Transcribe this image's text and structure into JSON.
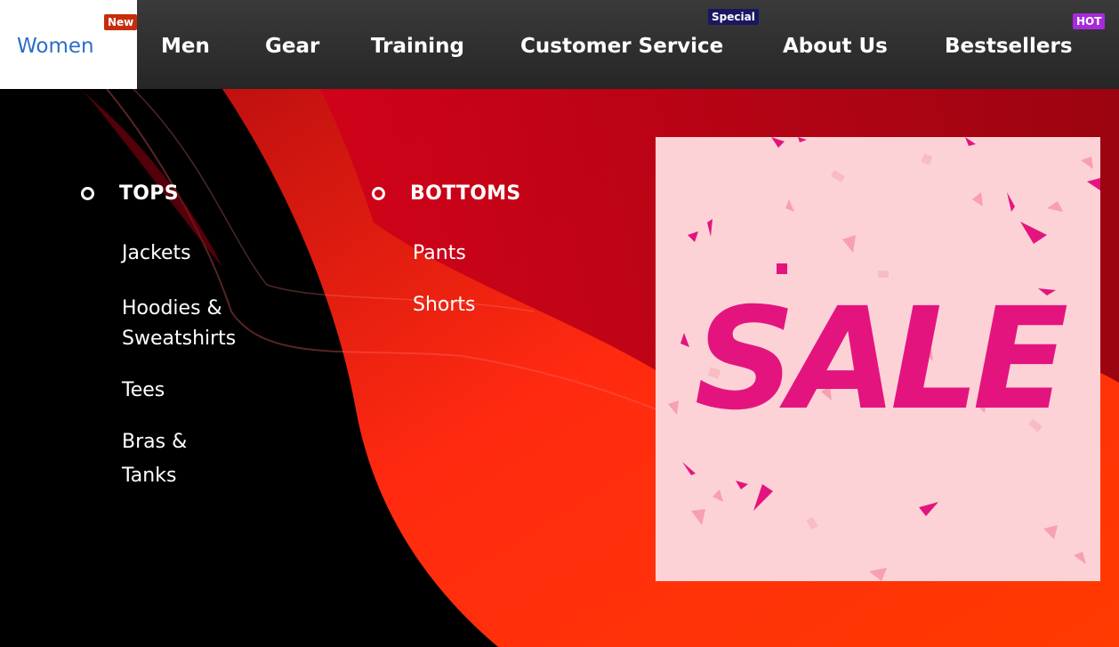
{
  "nav": {
    "items": [
      {
        "label": "Women"
      },
      {
        "label": "Men"
      },
      {
        "label": "Gear"
      },
      {
        "label": "Training"
      },
      {
        "label": "Customer Service"
      },
      {
        "label": "About Us"
      },
      {
        "label": "Bestsellers"
      }
    ],
    "badges": {
      "women": {
        "text": "New",
        "color": "#c62d0c"
      },
      "customer_service": {
        "text": "Special",
        "color": "#1a1760"
      },
      "bestsellers": {
        "text": "HOT",
        "color": "#a72adb"
      }
    },
    "active_color": "#2b6fc7"
  },
  "menu": {
    "tops": {
      "heading": "TOPS",
      "links": [
        "Jackets",
        "Hoodies &",
        "Sweatshirts",
        "Tees",
        "Bras &",
        "Tanks"
      ]
    },
    "bottoms": {
      "heading": "BOTTOMS",
      "links": [
        "Pants",
        "Shorts"
      ]
    },
    "promo": {
      "text": "SALE",
      "text_color": "#e4147f",
      "bg_color": "#fcd2d6"
    }
  }
}
